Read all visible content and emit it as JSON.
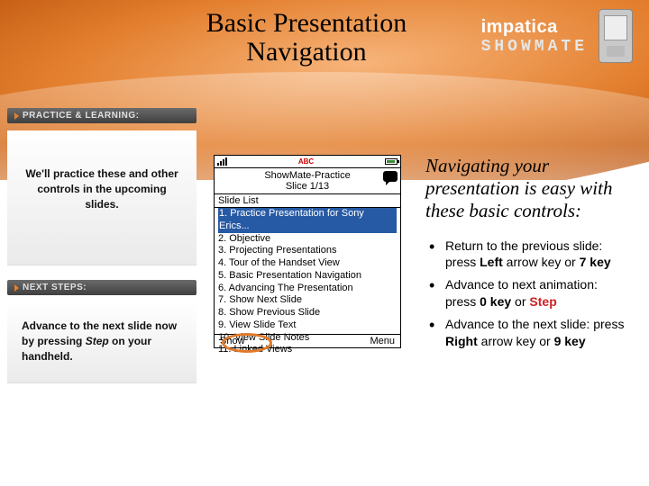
{
  "title": "Basic Presentation Navigation",
  "brand": {
    "name": "impatica",
    "product": "SHOWMATE"
  },
  "left": {
    "practice_heading": "PRACTICE & LEARNING:",
    "practice_text": "We'll practice these and other controls in the upcoming slides.",
    "next_heading": "NEXT STEPS:",
    "next_before": "Advance to the next slide now by pressing ",
    "next_step_word": "Step",
    "next_after": " on your handheld."
  },
  "phone": {
    "operator": "ABC",
    "title_line1": "ShowMate-Practice",
    "title_line2": "Slice 1/13",
    "list_heading": "Slide List",
    "items": [
      "1. Practice Presentation for Sony Erics...",
      "2. Objective",
      "3. Projecting Presentations",
      "4. Tour of the Handset View",
      "5. Basic Presentation Navigation",
      "6. Advancing The Presentation",
      "7. Show Next Slide",
      "8. Show Previous Slide",
      "9. View Slide Text",
      "10. View Slide Notes",
      "11. Linked Views"
    ],
    "softkey_left": "Show",
    "softkey_right": "Menu"
  },
  "right": {
    "intro": "Navigating your presentation is easy with these basic controls:",
    "bullets": [
      {
        "pre": "Return to the previous slide: press ",
        "b1": "Left",
        "mid": " arrow key or ",
        "b2": "7 key",
        "post": ""
      },
      {
        "pre": "Advance to next animation: press ",
        "b1": "0 key",
        "mid": " or ",
        "step": "Step",
        "post": ""
      },
      {
        "pre": "Advance to the next slide: press ",
        "b1": "Right",
        "mid": " arrow key or ",
        "b2": "9 key",
        "post": ""
      }
    ]
  }
}
